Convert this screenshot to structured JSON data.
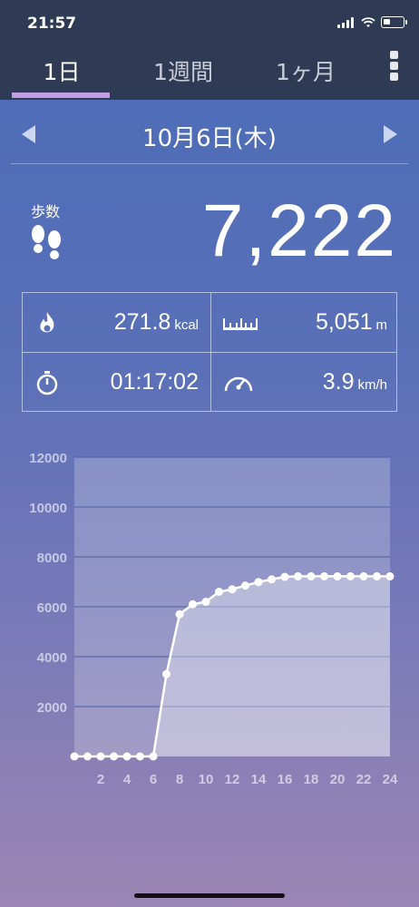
{
  "status": {
    "time": "21:57"
  },
  "tabs": [
    {
      "label": "1日",
      "active": true
    },
    {
      "label": "1週間",
      "active": false
    },
    {
      "label": "1ヶ月",
      "active": false
    }
  ],
  "date": "10月6日(木)",
  "steps": {
    "label": "歩数",
    "value": "7,222"
  },
  "stats": {
    "calories": {
      "value": "271.8",
      "unit": "kcal"
    },
    "distance": {
      "value": "5,051",
      "unit": "m"
    },
    "time": {
      "value": "01:17:02"
    },
    "speed": {
      "value": "3.9",
      "unit": "km/h"
    }
  },
  "colors": {
    "accent": "#c19de3",
    "header": "#2f3a55"
  },
  "icons": [
    "fire-icon",
    "ruler-icon",
    "stopwatch-icon",
    "speedometer-icon",
    "footprints-icon",
    "menu-icon"
  ],
  "chart_data": {
    "type": "area",
    "title": "",
    "xlabel": "",
    "ylabel": "",
    "xlim": [
      0,
      24
    ],
    "ylim": [
      0,
      12000
    ],
    "yticks": [
      2000,
      4000,
      6000,
      8000,
      10000,
      12000
    ],
    "xticks": [
      2,
      4,
      6,
      8,
      10,
      12,
      14,
      16,
      18,
      20,
      22,
      24
    ],
    "grid": true,
    "x": [
      0,
      1,
      2,
      3,
      4,
      5,
      6,
      7,
      8,
      9,
      10,
      11,
      12,
      13,
      14,
      15,
      16,
      17,
      18,
      19,
      20,
      21,
      22,
      23,
      24
    ],
    "values": [
      0,
      0,
      0,
      0,
      0,
      0,
      0,
      3300,
      5700,
      6100,
      6200,
      6600,
      6700,
      6850,
      6990,
      7100,
      7200,
      7222,
      7222,
      7222,
      7222,
      7222,
      7222,
      7222,
      7222
    ]
  }
}
